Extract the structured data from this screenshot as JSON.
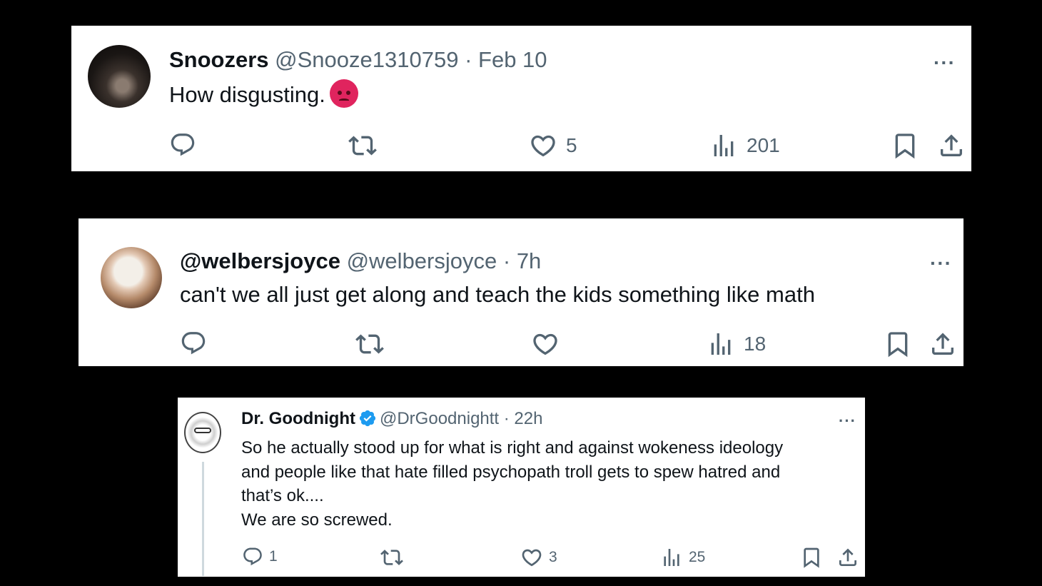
{
  "tweets": [
    {
      "name": "Snoozers",
      "handle": "@Snooze1310759",
      "sep": " · ",
      "time": "Feb 10",
      "text": "How disgusting.",
      "emoji_icon": "angry-face-icon",
      "replies": "",
      "retweets": "",
      "likes": "5",
      "views": "201",
      "more": "···"
    },
    {
      "name": "@welbersjoyce",
      "handle": "@welbersjoyce",
      "sep": " · ",
      "time": "7h",
      "text": "can't we all just get along and teach the kids something like math",
      "replies": "",
      "retweets": "",
      "likes": "",
      "views": "18",
      "more": "···"
    },
    {
      "name": "Dr. Goodnight",
      "verified": true,
      "handle": "@DrGoodnightt",
      "sep": " · ",
      "time": "22h",
      "lines": [
        "So he actually stood up for what is right and against wokeness ideology",
        "and people like that hate filled psychopath troll gets to spew hatred and",
        "that’s ok....",
        "We are so screwed."
      ],
      "replies": "1",
      "retweets": "",
      "likes": "3",
      "views": "25",
      "more": "···"
    }
  ],
  "colors": {
    "muted": "#536471",
    "text": "#0f1419",
    "verified": "#1d9bf0",
    "angry": "#e0245e"
  }
}
